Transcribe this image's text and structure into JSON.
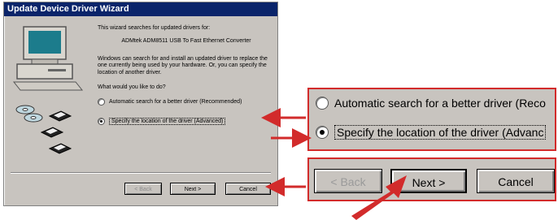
{
  "dialog": {
    "title": "Update Device Driver Wizard",
    "intro": "This wizard searches for updated drivers for:",
    "device": "ADMtek ADM8511 USB To Fast Ethernet Converter",
    "description": "Windows can search for and install an updated driver to replace the one currently being used by your hardware. Or, you can specify the location of another driver.",
    "question": "What would you like to do?",
    "options": [
      {
        "label": "Automatic search for a better driver (Recommended)",
        "selected": false
      },
      {
        "label": "Specify the location of the driver (Advanced)",
        "selected": true
      }
    ],
    "buttons": {
      "back": "< Back",
      "next": "Next >",
      "cancel": "Cancel"
    }
  },
  "zoom": {
    "options": [
      "Automatic search for a better driver (Reco",
      "Specify the location of the driver (Advanc"
    ],
    "buttons": {
      "back": "< Back",
      "next": "Next >",
      "cancel": "Cancel"
    }
  },
  "colors": {
    "callout_red": "#d22b2b",
    "title_bar": "#0a246a",
    "dialog_face": "#c8c4bf"
  },
  "icons": [
    "computer-icon",
    "cd-disk-icon",
    "floppy-disk-icon",
    "arrow-icon"
  ]
}
